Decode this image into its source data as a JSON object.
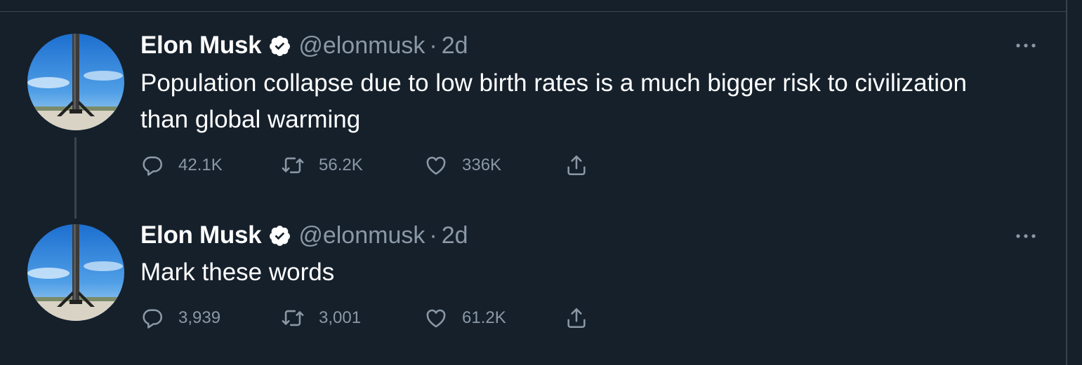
{
  "tweets": [
    {
      "author_name": "Elon Musk",
      "handle": "@elonmusk",
      "separator": "·",
      "time": "2d",
      "text": "Population collapse due to low birth rates is a much bigger risk to civilization than global warming",
      "replies": "42.1K",
      "retweets": "56.2K",
      "likes": "336K"
    },
    {
      "author_name": "Elon Musk",
      "handle": "@elonmusk",
      "separator": "·",
      "time": "2d",
      "text": "Mark these words",
      "replies": "3,939",
      "retweets": "3,001",
      "likes": "61.2K"
    }
  ],
  "icons": {
    "verified": "verified-badge-icon",
    "more": "more-options-icon",
    "reply": "reply-icon",
    "retweet": "retweet-icon",
    "like": "like-icon",
    "share": "share-icon"
  },
  "colors": {
    "background": "#15202b",
    "text": "#ffffff",
    "secondary_text": "#8b98a5",
    "divider": "#38444d"
  }
}
